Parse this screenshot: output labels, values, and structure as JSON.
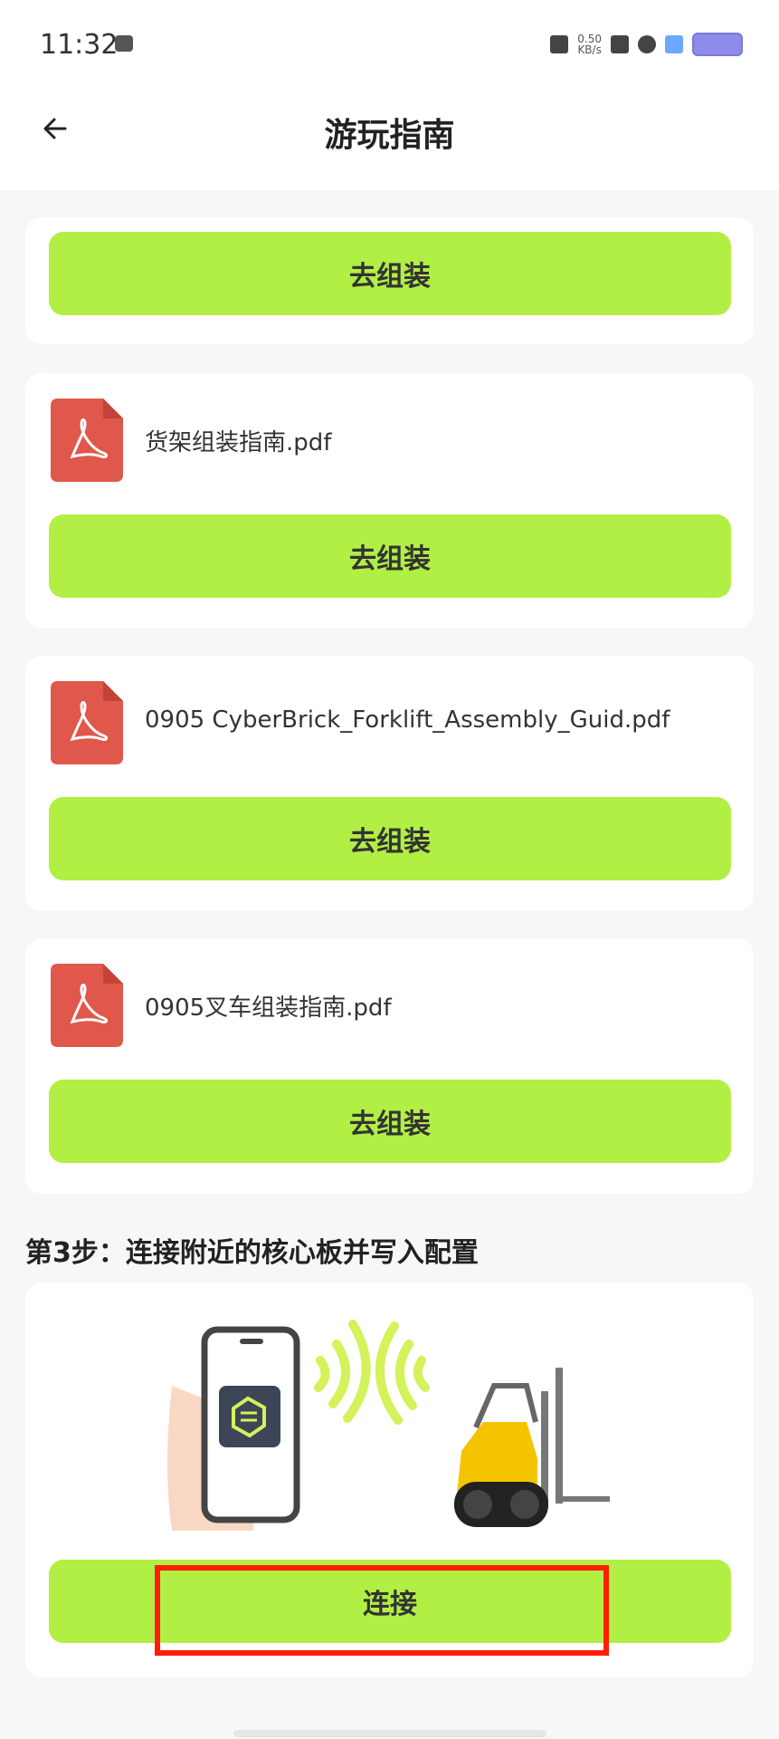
{
  "status_bar": {
    "time": "11:32",
    "net_speed": "0.50",
    "net_unit": "KB/s"
  },
  "header": {
    "title": "游玩指南"
  },
  "cards": [
    {
      "button_label": "去组装"
    },
    {
      "file_name": "货架组装指南.pdf",
      "button_label": "去组装"
    },
    {
      "file_name": "0905 CyberBrick_Forklift_Assembly_Guid.pdf",
      "button_label": "去组装"
    },
    {
      "file_name": "0905叉车组装指南.pdf",
      "button_label": "去组装"
    }
  ],
  "step3": {
    "title": "第3步：连接附近的核心板并写入配置",
    "connect_label": "连接"
  },
  "colors": {
    "accent_green": "#b1ef45",
    "pdf_red": "#e0574b",
    "highlight_red": "#ff1e00"
  },
  "icons": {
    "back": "arrow-left-icon",
    "pdf": "pdf-file-icon"
  }
}
